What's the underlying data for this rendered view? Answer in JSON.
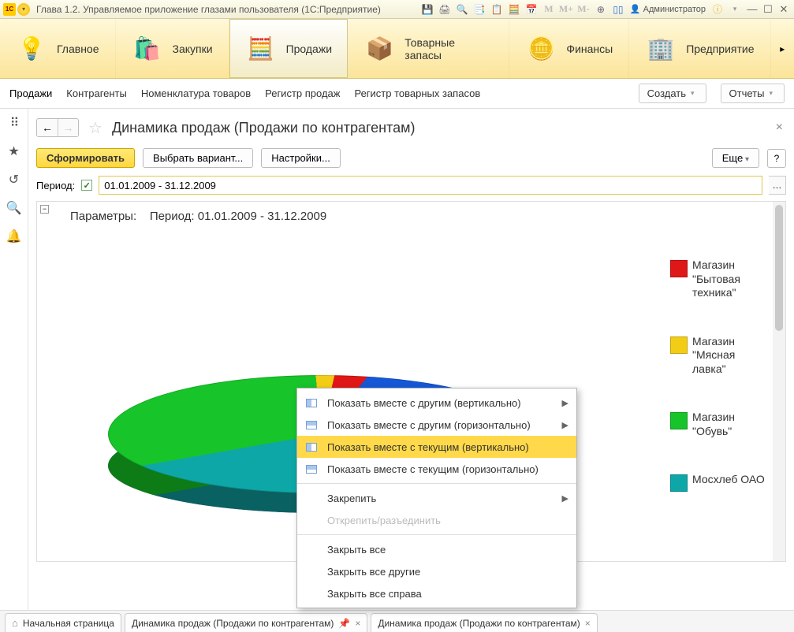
{
  "window": {
    "title": "Глава 1.2. Управляемое приложение глазами пользователя  (1С:Предприятие)",
    "user": "Администратор"
  },
  "mainnav": {
    "items": [
      {
        "label": "Главное",
        "icon": "💡"
      },
      {
        "label": "Закупки",
        "icon": "🛍️"
      },
      {
        "label": "Продажи",
        "icon": "🧮",
        "active": true
      },
      {
        "label": "Товарные запасы",
        "icon": "📦"
      },
      {
        "label": "Финансы",
        "icon": "🪙"
      },
      {
        "label": "Предприятие",
        "icon": "🏢"
      }
    ]
  },
  "subnav": {
    "items": [
      "Продажи",
      "Контрагенты",
      "Номенклатура товаров",
      "Регистр продаж",
      "Регистр товарных запасов"
    ],
    "create": "Создать",
    "reports": "Отчеты"
  },
  "page": {
    "title": "Динамика продаж (Продажи по контрагентам)",
    "buttons": {
      "form": "Сформировать",
      "variant": "Выбрать вариант...",
      "settings": "Настройки...",
      "more": "Еще",
      "help": "?"
    },
    "period_label": "Период:",
    "period_value": "01.01.2009 - 31.12.2009",
    "params_label": "Параметры:",
    "params_period": "Период: 01.01.2009 - 31.12.2009"
  },
  "chart_data": {
    "type": "pie",
    "title": "Динамика продаж (Продажи по контрагентам)",
    "series": [
      {
        "name": "Магазин \"Бытовая техника\"",
        "value": 7,
        "color": "#e01717"
      },
      {
        "name": "Магазин \"Мясная лавка\"",
        "value": 5,
        "color": "#f3cd15"
      },
      {
        "name": "Магазин \"Обувь\"",
        "value": 27,
        "color": "#17c42a"
      },
      {
        "name": "Мосхлеб ОАО",
        "value": 17,
        "color": "#0ea7a7"
      },
      {
        "name": "—",
        "value": 44,
        "color": "#1557d6"
      }
    ]
  },
  "legend": [
    {
      "label": "Магазин \"Бытовая техника\"",
      "color": "#e01717"
    },
    {
      "label": "Магазин \"Мясная лавка\"",
      "color": "#f3cd15"
    },
    {
      "label": "Магазин \"Обувь\"",
      "color": "#17c42a"
    },
    {
      "label": "Мосхлеб ОАО",
      "color": "#0ea7a7"
    }
  ],
  "contextmenu": {
    "items": [
      {
        "label": "Показать вместе с другим (вертикально)",
        "icon": "v",
        "sub": true
      },
      {
        "label": "Показать вместе с другим (горизонтально)",
        "icon": "h",
        "sub": true
      },
      {
        "label": "Показать вместе с текущим (вертикально)",
        "icon": "v",
        "hl": true
      },
      {
        "label": "Показать вместе с текущим (горизонтально)",
        "icon": "h"
      },
      {
        "label": "Закрепить",
        "sub": true
      },
      {
        "label": "Открепить/разъединить",
        "disabled": true
      },
      {
        "label": "Закрыть все"
      },
      {
        "label": "Закрыть все другие"
      },
      {
        "label": "Закрыть все справа"
      }
    ]
  },
  "tabs": [
    {
      "label": "Начальная страница",
      "home": true
    },
    {
      "label": "Динамика продаж (Продажи по контрагентам)",
      "closable": true,
      "pin": true
    },
    {
      "label": "Динамика продаж (Продажи по контрагентам)",
      "closable": true,
      "active": true
    }
  ]
}
